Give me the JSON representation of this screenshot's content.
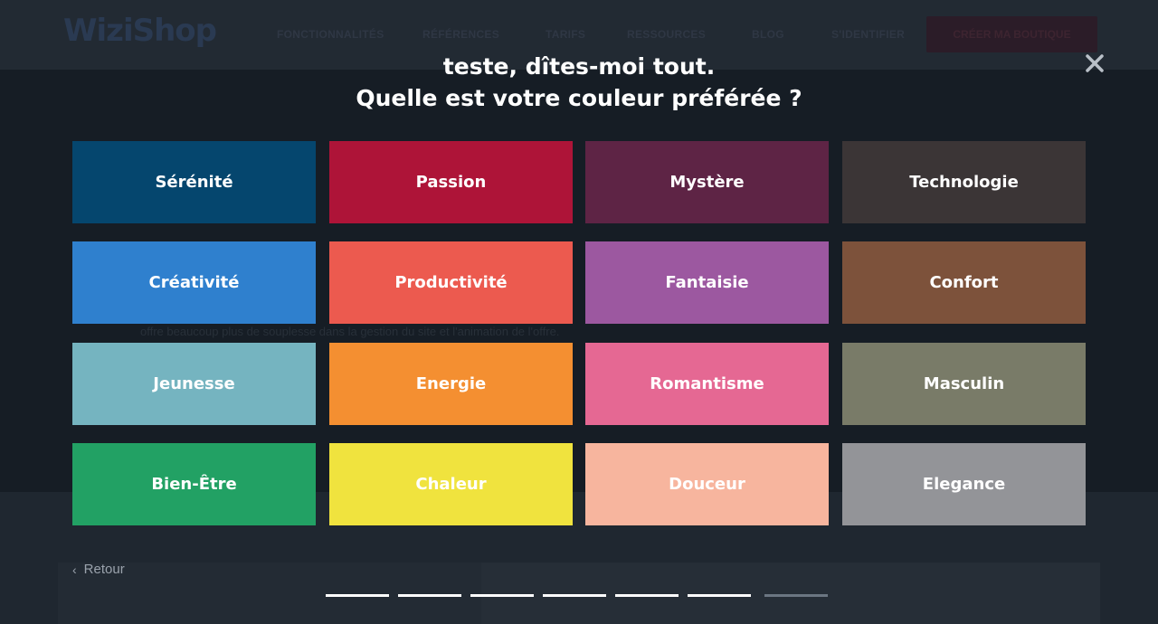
{
  "background": {
    "logo": "WiziShop",
    "nav": [
      {
        "label": "FONCTIONNALITÉS"
      },
      {
        "label": "RÉFÉRENCES"
      },
      {
        "label": "TARIFS"
      },
      {
        "label": "RESSOURCES"
      },
      {
        "label": "BLOG"
      },
      {
        "label": "S'IDENTIFIER"
      }
    ],
    "cta_label": "CRÉER MA BOUTIQUE",
    "body_text": "offre beaucoup plus de souplesse dans la gestion du site et l'animation de l'offre."
  },
  "modal": {
    "title_line1": "teste, dîtes-moi tout.",
    "title_line2": "Quelle est votre couleur préférée ?",
    "close_icon": "close-icon",
    "options": [
      {
        "label": "Sérénité",
        "color": "#05466e"
      },
      {
        "label": "Passion",
        "color": "#ae1438"
      },
      {
        "label": "Mystère",
        "color": "#5e2445"
      },
      {
        "label": "Technologie",
        "color": "#3b3536"
      },
      {
        "label": "Créativité",
        "color": "#2f80ce"
      },
      {
        "label": "Productivité",
        "color": "#ec5a4f"
      },
      {
        "label": "Fantaisie",
        "color": "#9c58a0"
      },
      {
        "label": "Confort",
        "color": "#7d523b"
      },
      {
        "label": "Jeunesse",
        "color": "#75b4c0"
      },
      {
        "label": "Energie",
        "color": "#f48f31"
      },
      {
        "label": "Romantisme",
        "color": "#e56893"
      },
      {
        "label": "Masculin",
        "color": "#797b68"
      },
      {
        "label": "Bien-Être",
        "color": "#22a164"
      },
      {
        "label": "Chaleur",
        "color": "#f0e33e"
      },
      {
        "label": "Douceur",
        "color": "#f7b59e"
      },
      {
        "label": "Elegance",
        "color": "#939498"
      }
    ],
    "back_label": "Retour",
    "progress": {
      "total_steps": 7,
      "completed_steps": 6
    }
  }
}
